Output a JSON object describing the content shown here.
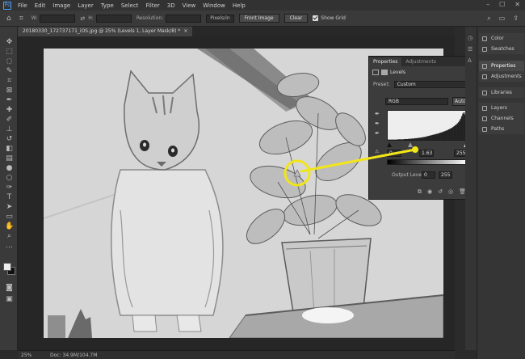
{
  "menubar": {
    "logo": "Ps",
    "items": [
      "File",
      "Edit",
      "Image",
      "Layer",
      "Type",
      "Select",
      "Filter",
      "3D",
      "View",
      "Window",
      "Help"
    ],
    "window_controls": [
      "–",
      "☐",
      "✕"
    ]
  },
  "options": {
    "w_label": "W:",
    "h_label": "H:",
    "resolution_label": "Resolution:",
    "unit_select": "Pixels/in",
    "front_image_button": "Front Image",
    "clear_button": "Clear",
    "show_grid_label": "Show Grid"
  },
  "document": {
    "tab_title": "20180330_172737171_iOS.jpg @ 25% (Levels 1, Layer Mask/8) *",
    "close_glyph": "×"
  },
  "properties": {
    "tab_properties": "Properties",
    "tab_adjustments": "Adjustments",
    "menu_glyph": "≡",
    "adjustment_name": "Levels",
    "preset_label": "Preset:",
    "preset_value": "Custom",
    "channel_value": "RGB",
    "auto_button": "Auto",
    "input_black": "0",
    "input_gamma": "1.63",
    "input_white": "255",
    "output_label": "Output Levels:",
    "output_black": "0",
    "output_white": "255",
    "histogram_bins": [
      1,
      1,
      1,
      1,
      1,
      1,
      1,
      1,
      1,
      2,
      2,
      2,
      2,
      2,
      2,
      3,
      3,
      3,
      3,
      4,
      4,
      4,
      5,
      5,
      5,
      6,
      6,
      7,
      7,
      8,
      8,
      9,
      10,
      10,
      11,
      12,
      13,
      14,
      15,
      16,
      17,
      18,
      19,
      20,
      21,
      22,
      23,
      24,
      26,
      27,
      28,
      30,
      31,
      33,
      34,
      36,
      38,
      40,
      42,
      44,
      47,
      50,
      53,
      56,
      60,
      64,
      70,
      77,
      86,
      95,
      100,
      92,
      80,
      70
    ]
  },
  "status": {
    "zoom": "25%",
    "doc_info": "Doc: 34.9M/104.7M"
  },
  "panels": {
    "group1": [
      "Color",
      "Swatches"
    ],
    "group2": [
      "Properties",
      "Adjustments"
    ],
    "group3": [
      "Libraries"
    ],
    "group4": [
      "Layers",
      "Channels",
      "Paths"
    ]
  },
  "colors": {
    "callout_yellow": "#f2e51a",
    "foreground": "#eeeeee",
    "background": "#111111"
  }
}
